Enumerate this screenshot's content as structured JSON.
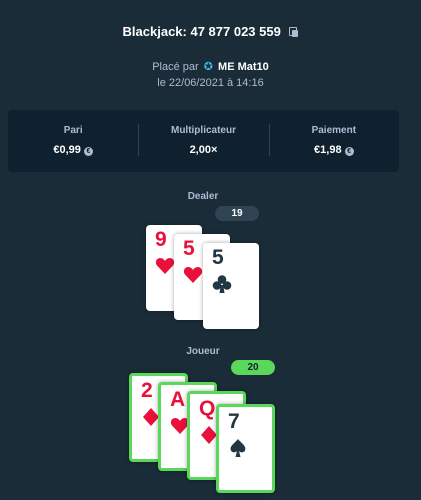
{
  "header": {
    "title": "Blackjack: 47 877 023 559",
    "placed_prefix": "Placé par",
    "username": "ME Mat10",
    "date": "le 22/06/2021 à 14:16"
  },
  "stats": {
    "bet_label": "Pari",
    "bet_value": "€0,99",
    "multiplier_label": "Multiplicateur",
    "multiplier_value": "2,00×",
    "payout_label": "Paiement",
    "payout_value": "€1,98",
    "payout_color": "#5bd85b"
  },
  "dealer": {
    "label": "Dealer",
    "score": "19",
    "cards": [
      {
        "rank": "9",
        "suit": "heart-icon"
      },
      {
        "rank": "5",
        "suit": "heart-icon"
      },
      {
        "rank": "5",
        "suit": "club-icon"
      }
    ]
  },
  "player": {
    "label": "Joueur",
    "score": "20",
    "cards": [
      {
        "rank": "2",
        "suit": "diamond-icon"
      },
      {
        "rank": "A",
        "suit": "heart-icon"
      },
      {
        "rank": "Q",
        "suit": "diamond-icon"
      },
      {
        "rank": "7",
        "suit": "spade-icon"
      }
    ]
  },
  "colors": {
    "background": "#1a2c38",
    "panel": "#0f212e",
    "win": "#5bd85b",
    "red_suit": "#e9113c",
    "black_suit": "#213743"
  }
}
